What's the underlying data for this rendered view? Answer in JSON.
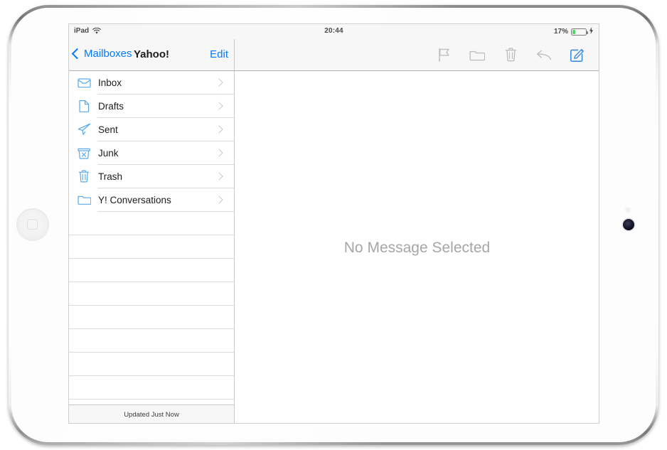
{
  "device": {
    "name": "ipad",
    "orientation": "landscape",
    "home_button": "home-button-icon",
    "front_camera": "camera-icon"
  },
  "status_bar": {
    "device_label": "iPad",
    "wifi_icon": "wifi-icon",
    "time": "20:44",
    "battery_percent_label": "17%",
    "battery_level": 17,
    "battery_fill_color": "#53d769",
    "charging_icon": "⚡"
  },
  "nav_bar": {
    "back_label": "Mailboxes",
    "back_icon": "chevron-left-icon",
    "title": "Yahoo!",
    "edit_label": "Edit",
    "accent_color": "#007aff",
    "tools": [
      {
        "name": "flag-icon",
        "label": "Flag",
        "enabled": false
      },
      {
        "name": "folder-icon",
        "label": "Move to Folder",
        "enabled": false
      },
      {
        "name": "trash-icon",
        "label": "Delete",
        "enabled": false
      },
      {
        "name": "reply-icon",
        "label": "Reply",
        "enabled": false
      },
      {
        "name": "compose-icon",
        "label": "Compose",
        "enabled": true
      }
    ]
  },
  "sidebar": {
    "mailboxes": [
      {
        "label": "Inbox",
        "icon": "inbox-icon"
      },
      {
        "label": "Drafts",
        "icon": "drafts-icon"
      },
      {
        "label": "Sent",
        "icon": "sent-icon"
      },
      {
        "label": "Junk",
        "icon": "junk-icon"
      },
      {
        "label": "Trash",
        "icon": "trash-icon"
      },
      {
        "label": "Y! Conversations",
        "icon": "folder-icon"
      }
    ],
    "empty_row_count": 9,
    "footer_status": "Updated Just Now"
  },
  "detail": {
    "empty_message": "No Message Selected"
  }
}
